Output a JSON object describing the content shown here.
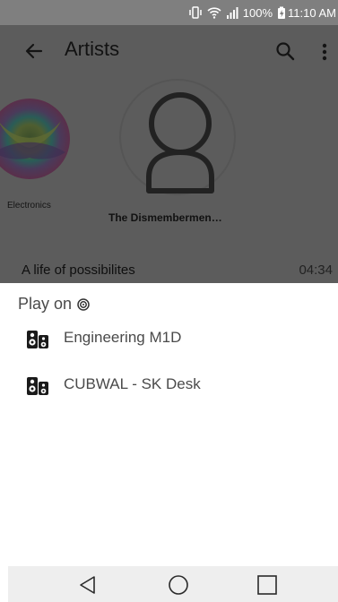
{
  "status_bar": {
    "battery": "100%",
    "time": "11:10 AM",
    "icons": [
      "vibrate-icon",
      "wifi-icon",
      "signal-icon",
      "battery-charging-icon"
    ]
  },
  "app": {
    "title": "Artists",
    "left_artist_label": "Electronics",
    "center_artist_label": "The Dismembermen…",
    "now_playing": {
      "title": "A life of possibilites",
      "time": "04:34"
    }
  },
  "sheet": {
    "heading": "Play on",
    "devices": [
      {
        "label": "Engineering M1D",
        "icon": "speaker-icon"
      },
      {
        "label": "CUBWAL - SK Desk",
        "icon": "speaker-icon"
      }
    ]
  },
  "nav": {
    "icons": [
      "back-triangle-icon",
      "home-circle-icon",
      "recents-square-icon"
    ]
  }
}
